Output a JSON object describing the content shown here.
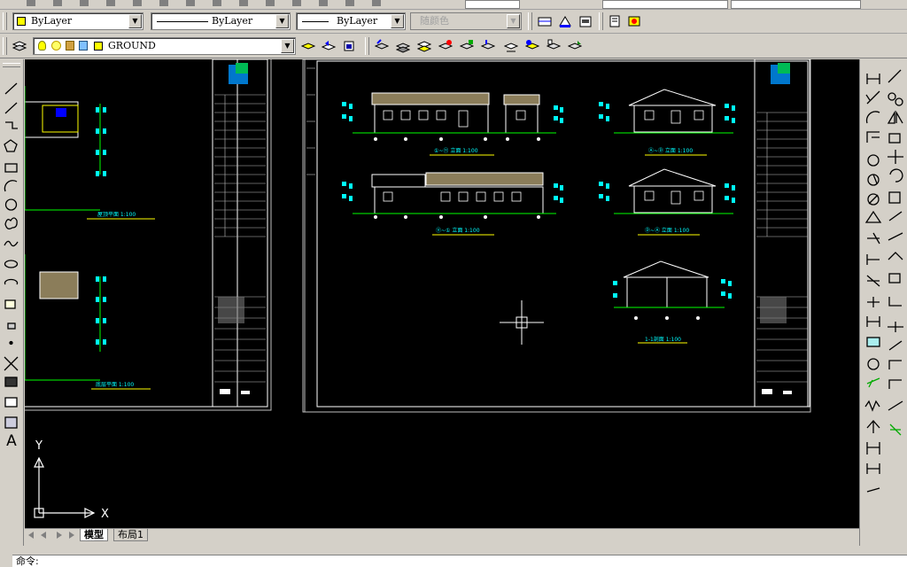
{
  "toolbar_properties": {
    "color_value": "ByLayer",
    "color_swatch": "#ffff00",
    "linetype_value": "ByLayer",
    "lineweight_value": "ByLayer",
    "plotstyle_value": "随颜色"
  },
  "toolbar_layers": {
    "layer_value": "GROUND",
    "layer_swatch": "#ffff00"
  },
  "canvas": {
    "background": "#000000",
    "ucs_x_label": "X",
    "ucs_y_label": "Y",
    "titles": {
      "plan1": "屋顶平面 1:100",
      "plan2": "底层平面 1:100",
      "elev1": "①~⑪ 立面 1:100",
      "elev2": "Ⓐ~Ⓓ 立面 1:100",
      "elev3": "⑪~① 立面 1:100",
      "elev4": "Ⓓ~Ⓐ 立面 1:100",
      "section": "1-1剖面 1:100"
    }
  },
  "tabs": {
    "model": "模型",
    "layout1": "布局1"
  },
  "command": {
    "prompt": "命令:"
  },
  "colors": {
    "accent_cyan": "#00ffff",
    "accent_green": "#00ff00",
    "accent_blue": "#0000ff",
    "accent_yellow": "#ffff00",
    "roof_fill": "#8b7d5a"
  }
}
